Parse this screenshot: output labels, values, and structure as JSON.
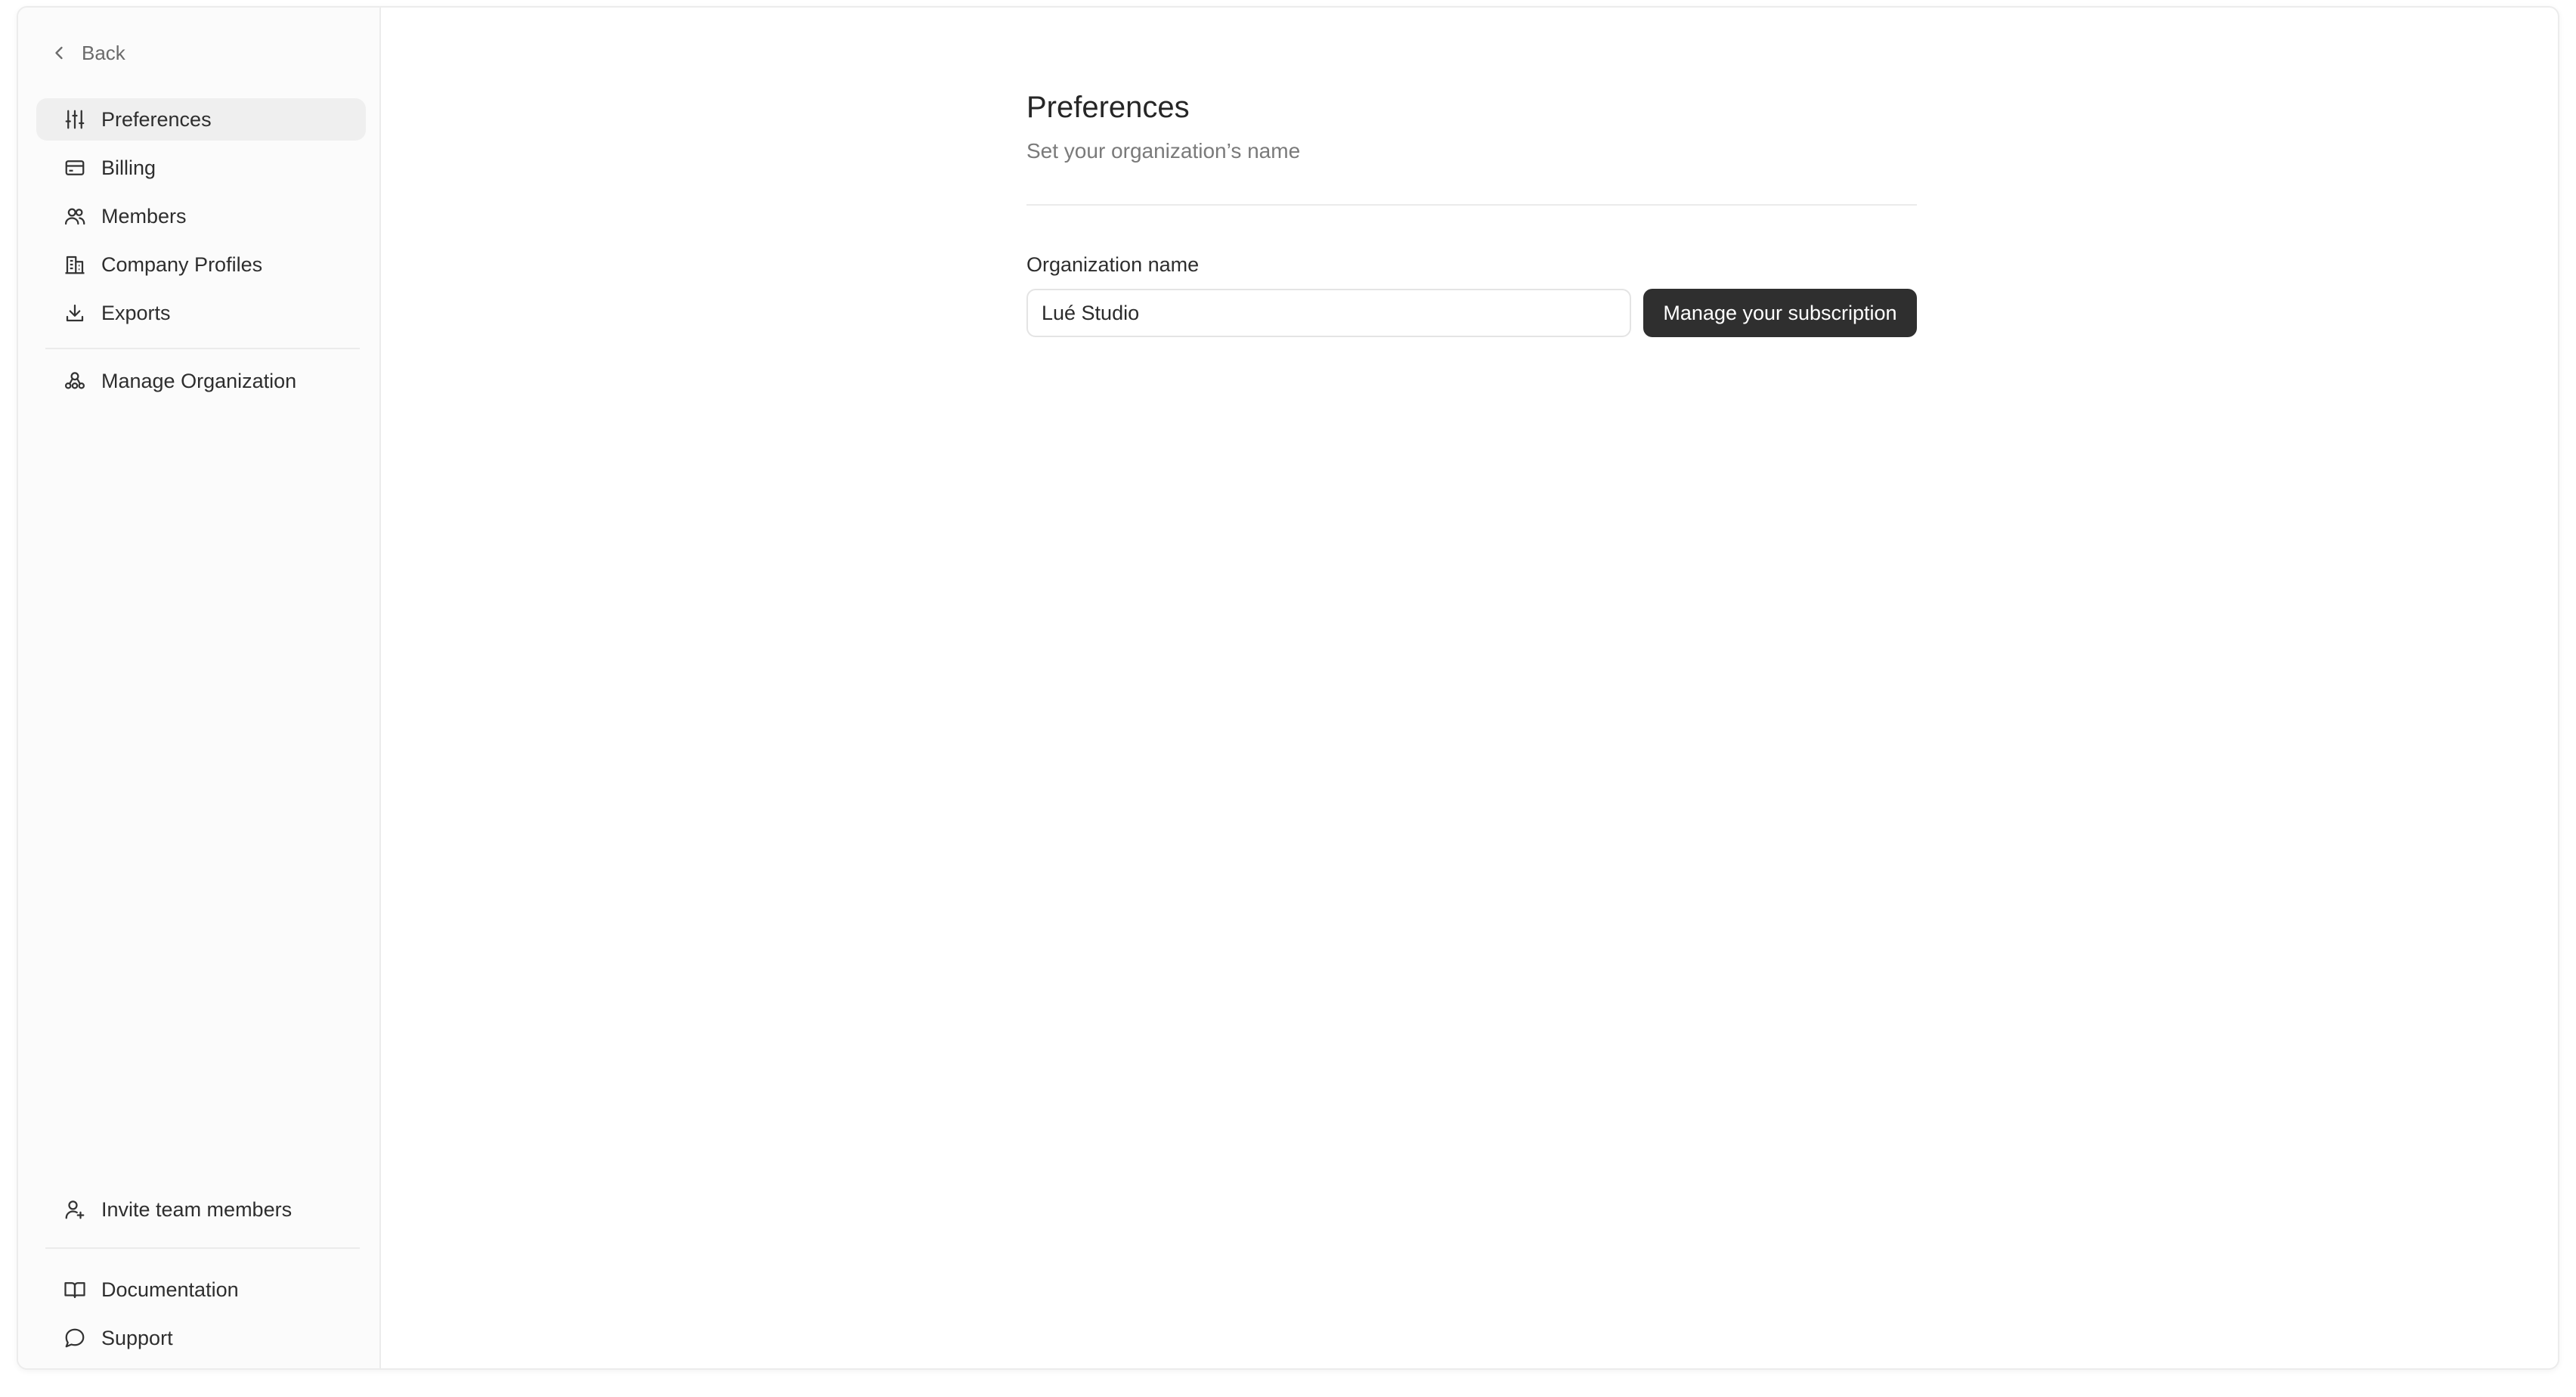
{
  "sidebar": {
    "back_label": "Back",
    "items": [
      {
        "label": "Preferences",
        "icon": "sliders-icon",
        "active": true
      },
      {
        "label": "Billing",
        "icon": "credit-card-icon"
      },
      {
        "label": "Members",
        "icon": "users-icon"
      },
      {
        "label": "Company Profiles",
        "icon": "building-icon"
      },
      {
        "label": "Exports",
        "icon": "download-icon"
      },
      {
        "label": "Manage Organization",
        "icon": "organization-icon"
      }
    ],
    "footer_items": [
      {
        "label": "Invite team members",
        "icon": "user-plus-icon"
      },
      {
        "label": "Documentation",
        "icon": "book-icon"
      },
      {
        "label": "Support",
        "icon": "chat-bubble-icon"
      }
    ]
  },
  "main": {
    "title": "Preferences",
    "subtitle": "Set your organization’s name",
    "field_label": "Organization name",
    "org_name_value": "Lué Studio",
    "manage_button_label": "Manage your subscription"
  },
  "colors": {
    "active_item_bg": "#efefef",
    "button_bg": "#2f2f2f",
    "sidebar_bg": "#fbfbfb"
  }
}
